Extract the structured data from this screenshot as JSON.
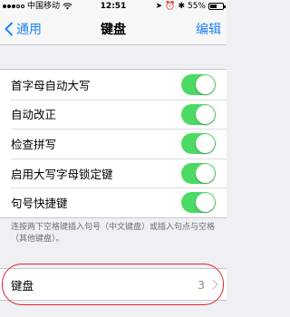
{
  "status_bar": {
    "carrier": "中国移动",
    "network_icon": "wifi-icon",
    "time": "12:51",
    "battery_percent": "55%",
    "battery_level": 0.55
  },
  "nav": {
    "back_label": "通用",
    "title": "键盘",
    "edit_label": "编辑"
  },
  "settings": [
    {
      "label": "首字母自动大写",
      "on": true
    },
    {
      "label": "自动改正",
      "on": true
    },
    {
      "label": "检查拼写",
      "on": true
    },
    {
      "label": "启用大写字母锁定键",
      "on": true
    },
    {
      "label": "句号快捷键",
      "on": true
    }
  ],
  "footnote": "连按两下空格键插入句号（中文键盘）或插入句点与空格（其他键盘）。",
  "keyboard_row": {
    "label": "键盘",
    "value": "3"
  },
  "colors": {
    "accent": "#1e84f5",
    "toggle_on": "#4cd964",
    "highlight": "#e0232b"
  }
}
